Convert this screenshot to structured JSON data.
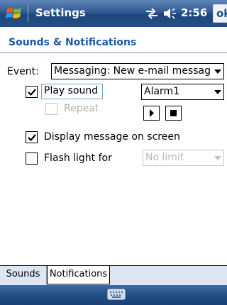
{
  "titlebar": {
    "title": "Settings",
    "time": "2:56",
    "ok_label": "ok",
    "icons": [
      "windows-start-icon",
      "connectivity-icon",
      "volume-icon"
    ]
  },
  "page": {
    "header": "Sounds & Notifications"
  },
  "form": {
    "event_label": "Event:",
    "event_value": "Messaging: New e-mail messag",
    "play_sound_label": "Play sound",
    "play_sound_checked": true,
    "sound_value": "Alarm1",
    "repeat_label": "Repeat",
    "repeat_checked": false,
    "display_message_label": "Display message on screen",
    "display_message_checked": true,
    "flash_light_label": "Flash light for",
    "flash_light_checked": false,
    "flash_duration_value": "No limit"
  },
  "tabs": [
    {
      "label": "Sounds",
      "active": false
    },
    {
      "label": "Notifications",
      "active": true
    }
  ],
  "colors": {
    "accent": "#1e5aa8",
    "titlebar": "#2f5a92",
    "tabstrip": "#dde6f2"
  }
}
